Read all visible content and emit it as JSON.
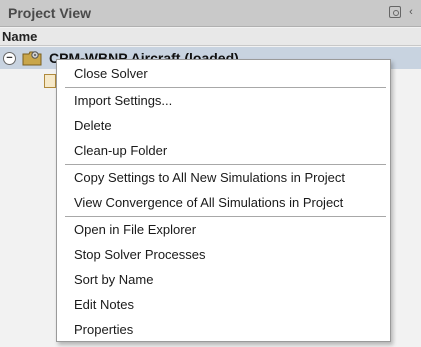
{
  "panel": {
    "title": "Project View",
    "column_header": "Name"
  },
  "tree": {
    "root_label": "CPM-WBNP Aircraft (loaded)",
    "root_toggle": "−"
  },
  "context_menu": {
    "groups": [
      [
        "Close Solver"
      ],
      [
        "Import Settings...",
        "Delete",
        "Clean-up Folder"
      ],
      [
        "Copy Settings to All New Simulations in Project",
        "View Convergence of All Simulations in Project"
      ],
      [
        "Open in File Explorer",
        "Stop Solver Processes",
        "Sort by Name",
        "Edit Notes",
        "Properties"
      ]
    ],
    "items": {
      "close_solver": "Close Solver",
      "import_settings": "Import Settings...",
      "delete": "Delete",
      "cleanup_folder": "Clean-up Folder",
      "copy_settings": "Copy Settings to All New Simulations in Project",
      "view_convergence": "View Convergence of All Simulations in Project",
      "open_explorer": "Open in File Explorer",
      "stop_solver": "Stop Solver Processes",
      "sort_by_name": "Sort by Name",
      "edit_notes": "Edit Notes",
      "properties": "Properties"
    }
  },
  "colors": {
    "title_bar": "#c9c9c9",
    "selected_row": "#c8d3e0",
    "menu_bg": "#ffffff"
  },
  "icons": {
    "pin": "pin-icon",
    "collapse_panel": "chevron-left-icon",
    "project_folder": "folder-gear-icon",
    "child_doc": "document-icon"
  }
}
